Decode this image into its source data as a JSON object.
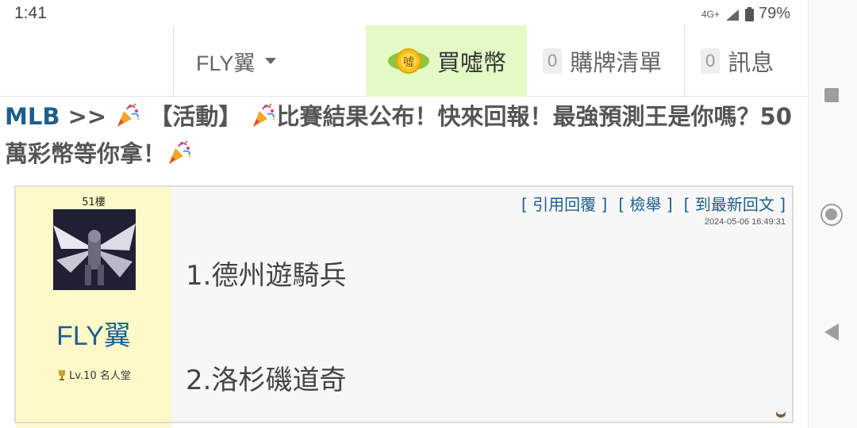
{
  "status": {
    "time": "1:41",
    "network": "4G+",
    "battery": "79%"
  },
  "nav": {
    "user": "FLY翼",
    "buy_label": "買噓幣",
    "coin_icon_text": "噓",
    "cart_count": "0",
    "cart_label": "購牌清單",
    "msg_count": "0",
    "msg_label": "訊息"
  },
  "thread": {
    "category": "MLB",
    "separator": ">>",
    "title_part1": "【活動】",
    "title_part2": "比賽結果公布！快來回報！最強預測王是你嗎？50萬彩幣等你拿！"
  },
  "post": {
    "floor": "51樓",
    "author": "FLY翼",
    "level": "Lv.10 名人堂",
    "actions": [
      "[ 引用回覆 ]",
      "[ 檢舉 ]",
      "[ 到最新回文 ]"
    ],
    "timestamp": "2024-05-06 16:49:31",
    "lines": [
      "1.德州遊騎兵",
      "2.洛杉磯道奇"
    ]
  },
  "icons": {
    "caret": "chevron-down-icon",
    "coin": "coin-icon",
    "party": "party-popper-icon",
    "trophy": "trophy-icon",
    "recent": "square-icon",
    "home": "home-circle-icon",
    "back": "back-triangle-icon"
  },
  "colors": {
    "accent": "#1d5f8c",
    "buy_bg": "#e3fbc5",
    "profile_bg": "#fff9c9"
  }
}
